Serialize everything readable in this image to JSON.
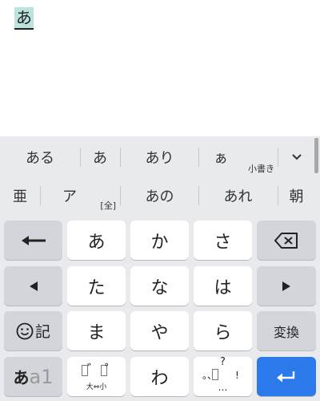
{
  "composing_text": "あ",
  "candidates_row1": [
    {
      "label": "ある"
    },
    {
      "label": "あ"
    },
    {
      "label": "あり"
    },
    {
      "label": "ぁ",
      "sub": "小書き"
    }
  ],
  "candidates_row2": [
    {
      "label": "亜"
    },
    {
      "label": "ア",
      "sub": "[全]"
    },
    {
      "label": "あの"
    },
    {
      "label": "あれ"
    },
    {
      "label": "朝"
    }
  ],
  "keys": {
    "row1": [
      "あ",
      "か",
      "さ"
    ],
    "row2": [
      "た",
      "な",
      "は"
    ],
    "row3": [
      "ま",
      "や",
      "ら"
    ],
    "row4_center": "わ",
    "kigou_label": "記",
    "henkan_label": "変換",
    "kana_a": "あ",
    "kana_a1": "a1",
    "dakuten": "゛",
    "handakuten": "゜",
    "daishou": "大⇔小",
    "punct_q": "?",
    "punct_marks": "。、",
    "punct_excl": "!",
    "punct_dots": "…"
  },
  "colors": {
    "keyboard_bg": "#e9eaee",
    "accent": "#2b79ea",
    "composing_highlight": "#bde3df"
  }
}
